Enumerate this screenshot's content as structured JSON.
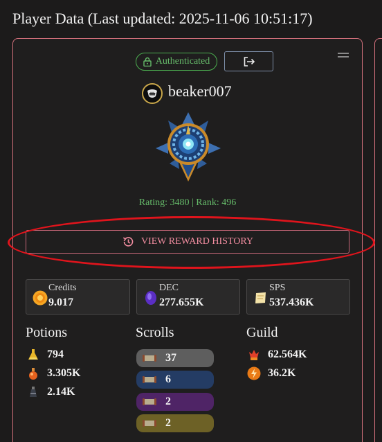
{
  "page": {
    "title": "Player Data (Last updated: 2025-11-06 10:51:17)"
  },
  "profile": {
    "auth_label": "Authenticated",
    "username": "beaker007",
    "rating_rank": "Rating: 3480 | Rank: 496",
    "reward_history_label": "VIEW REWARD HISTORY"
  },
  "stats": [
    {
      "label": "Credits",
      "value": "9.017",
      "icon": "credits-coin-icon"
    },
    {
      "label": "DEC",
      "value": "277.655K",
      "icon": "dec-gem-icon"
    },
    {
      "label": "SPS",
      "value": "537.436K",
      "icon": "sps-scroll-icon"
    }
  ],
  "potions": {
    "title": "Potions",
    "items": [
      {
        "value": "794",
        "icon": "gold-potion-icon"
      },
      {
        "value": "3.305K",
        "icon": "legendary-potion-icon"
      },
      {
        "value": "2.14K",
        "icon": "alchemy-potion-icon"
      }
    ]
  },
  "scrolls": {
    "title": "Scrolls",
    "items": [
      {
        "value": "37",
        "color": "#5e5e5e"
      },
      {
        "value": "6",
        "color": "#243c64"
      },
      {
        "value": "2",
        "color": "#4f2466"
      },
      {
        "value": "2",
        "color": "#6d6126"
      }
    ]
  },
  "guild": {
    "title": "Guild",
    "items": [
      {
        "value": "62.564K",
        "icon": "guild-crown-icon"
      },
      {
        "value": "36.2K",
        "icon": "guild-merit-icon"
      }
    ]
  },
  "colors": {
    "accent": "#d9737f",
    "success": "#66bb6a",
    "annotation": "#e0141c"
  }
}
